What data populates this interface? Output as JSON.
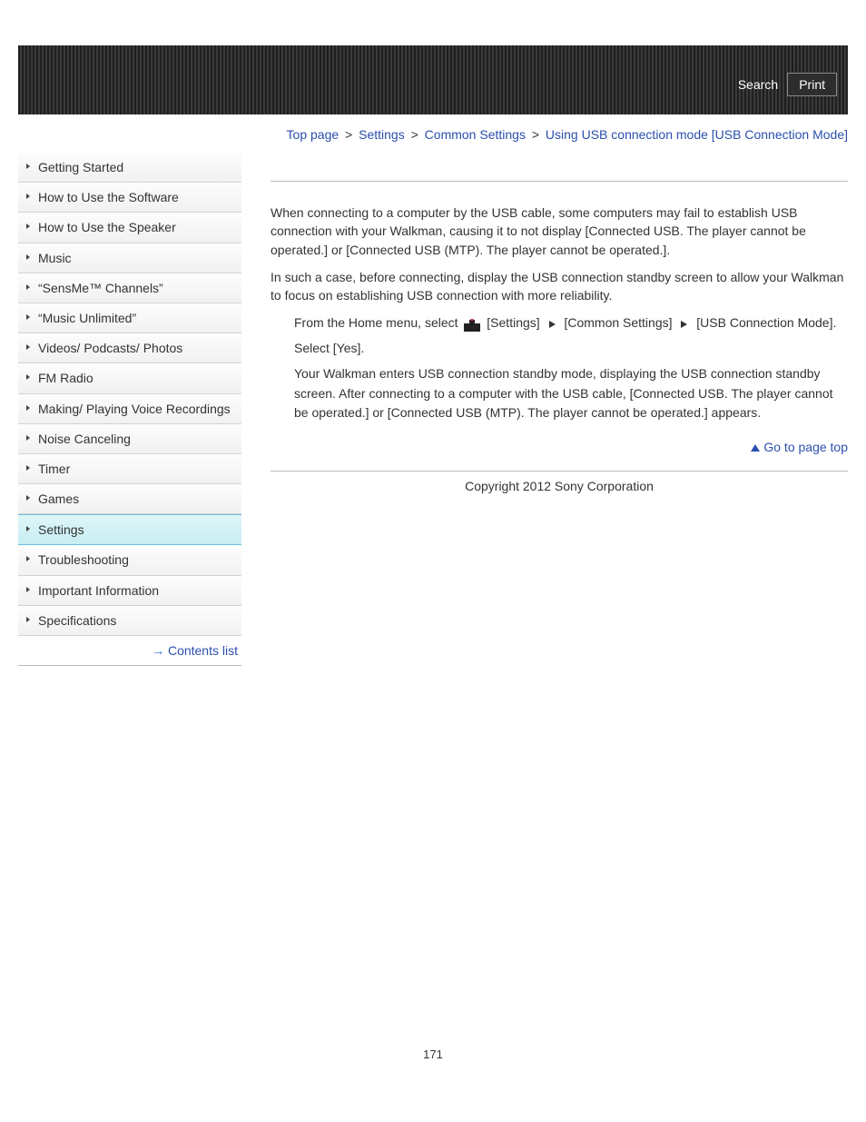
{
  "header": {
    "search_label": "Search",
    "print_label": "Print"
  },
  "sidebar": {
    "items": [
      {
        "label": "Getting Started",
        "active": false
      },
      {
        "label": "How to Use the Software",
        "active": false
      },
      {
        "label": "How to Use the Speaker",
        "active": false
      },
      {
        "label": "Music",
        "active": false
      },
      {
        "label": "“SensMe™ Channels”",
        "active": false
      },
      {
        "label": "“Music Unlimited”",
        "active": false
      },
      {
        "label": "Videos/ Podcasts/ Photos",
        "active": false
      },
      {
        "label": "FM Radio",
        "active": false
      },
      {
        "label": "Making/ Playing Voice Recordings",
        "active": false
      },
      {
        "label": "Noise Canceling",
        "active": false
      },
      {
        "label": "Timer",
        "active": false
      },
      {
        "label": "Games",
        "active": false
      },
      {
        "label": "Settings",
        "active": true
      },
      {
        "label": "Troubleshooting",
        "active": false
      },
      {
        "label": "Important Information",
        "active": false
      },
      {
        "label": "Specifications",
        "active": false
      }
    ],
    "contents_list_label": "Contents list"
  },
  "breadcrumbs": {
    "top": "Top page",
    "sep": ">",
    "settings": "Settings",
    "common": "Common Settings",
    "current": "Using USB connection mode [USB Connection Mode]"
  },
  "body": {
    "p1": "When connecting to a computer by the USB cable, some computers may fail to establish USB connection with your Walkman, causing it to not display [Connected USB. The player cannot be operated.] or [Connected USB (MTP). The player cannot be operated.].",
    "p2": "In such a case, before connecting, display the USB connection standby screen to allow your Walkman to focus on establishing USB connection with more reliability.",
    "step1_a": "From the Home menu, select ",
    "step1_b": " [Settings] ",
    "step1_c": " [Common Settings] ",
    "step1_d": " [USB Connection Mode].",
    "step2": "Select [Yes].",
    "step2_detail": "Your Walkman enters USB connection standby mode, displaying the USB connection standby screen. After connecting to a computer with the USB cable, [Connected USB. The player cannot be operated.] or [Connected USB (MTP). The player cannot be operated.] appears.",
    "goto_top": "Go to page top"
  },
  "footer": {
    "copyright": "Copyright 2012 Sony Corporation",
    "page_number": "171"
  }
}
